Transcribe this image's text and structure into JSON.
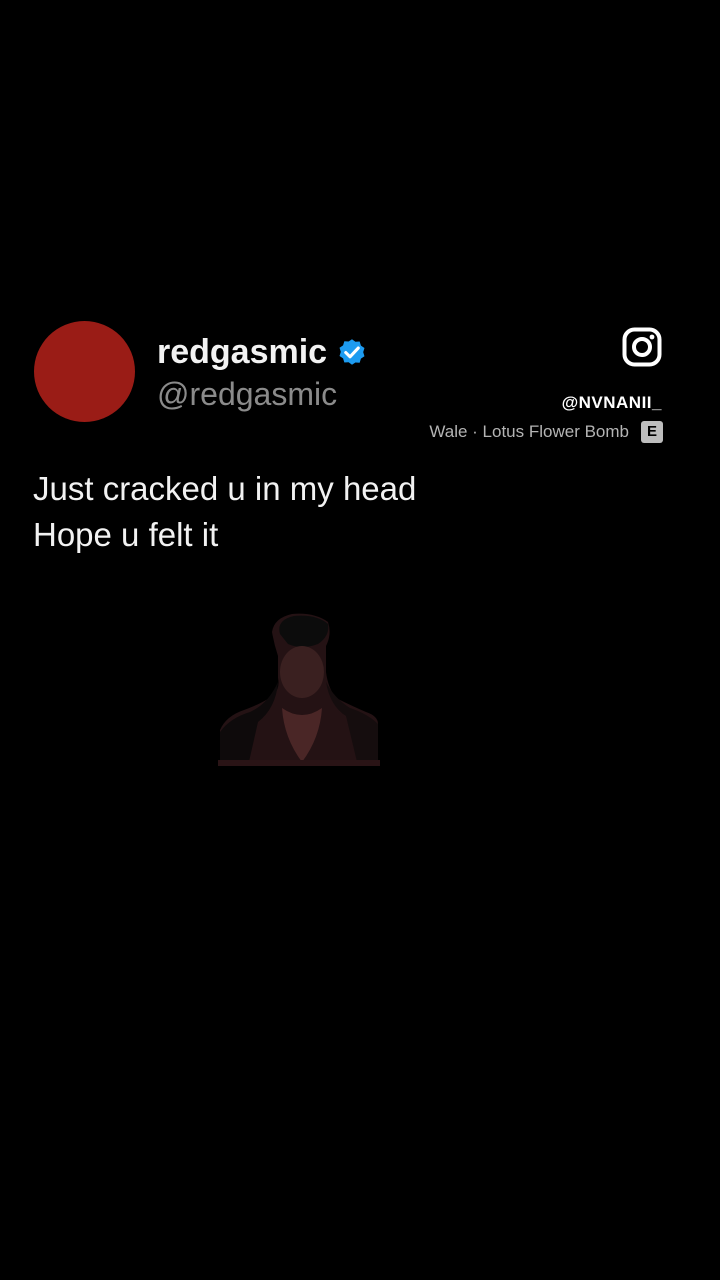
{
  "tweet": {
    "author": {
      "display_name": "redgasmic",
      "handle": "@redgasmic",
      "verified": true,
      "avatar_color": "#9a1c16",
      "verified_badge_color": "#1d9bf0"
    },
    "lines": [
      "Just cracked u in my head",
      "Hope u felt it"
    ]
  },
  "overlay": {
    "platform_icon": "instagram-icon",
    "ig_handle": "@NVNANII_",
    "song": {
      "text": "Wale · Lotus Flower Bomb",
      "explicit_label": "E"
    }
  },
  "media": {
    "icon": "person-cutout-image"
  }
}
